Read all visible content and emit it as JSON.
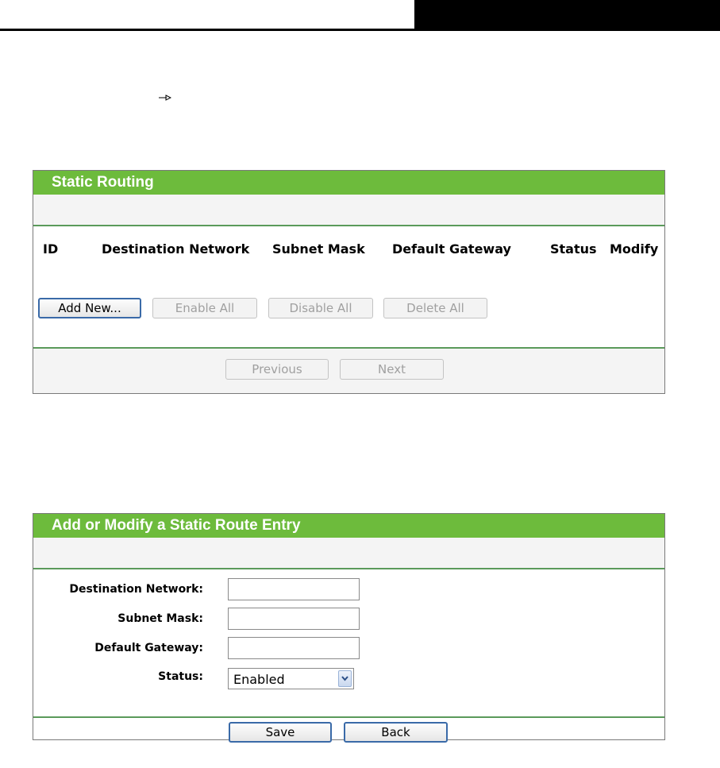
{
  "static_routing": {
    "title": "Static Routing",
    "columns": [
      "ID",
      "Destination Network",
      "Subnet Mask",
      "Default Gateway",
      "Status",
      "Modify"
    ],
    "buttons": {
      "add_new": "Add New...",
      "enable_all": "Enable All",
      "disable_all": "Disable All",
      "delete_all": "Delete All",
      "previous": "Previous",
      "next": "Next"
    }
  },
  "route_entry": {
    "title": "Add or Modify a Static Route Entry",
    "labels": {
      "destination": "Destination Network:",
      "subnet": "Subnet Mask:",
      "gateway": "Default Gateway:",
      "status": "Status:"
    },
    "values": {
      "destination": "",
      "subnet": "",
      "gateway": "",
      "status": "Enabled"
    },
    "buttons": {
      "save": "Save",
      "back": "Back"
    }
  },
  "colors": {
    "title_bar": "#6dbb3c",
    "divider": "#5a9a5a"
  }
}
